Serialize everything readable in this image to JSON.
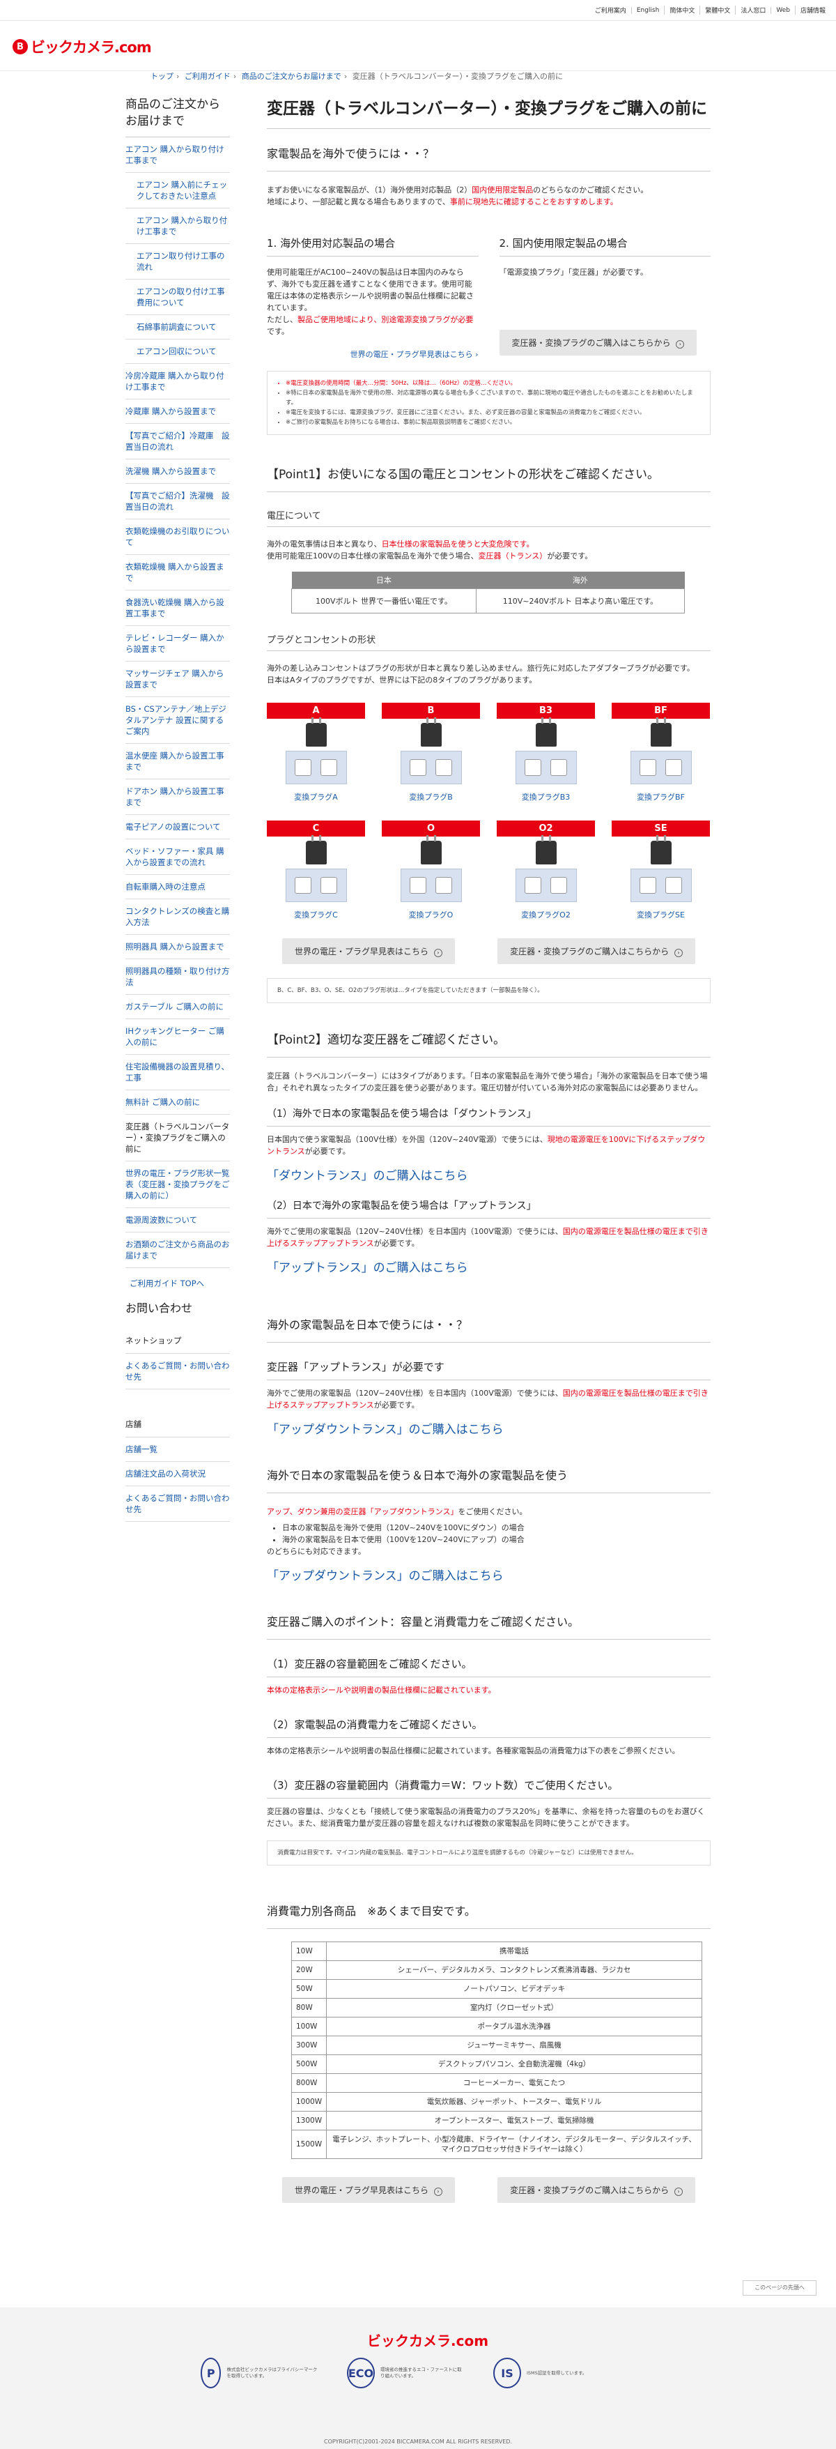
{
  "utility": {
    "links": [
      "ご利用案内",
      "English",
      "簡体中文",
      "繁體中文",
      "法人窓口",
      "Web",
      "店舗情報"
    ]
  },
  "header": {
    "logo_mark": "B",
    "logo_text": "ビックカメラ.com"
  },
  "breadcrumb": {
    "items": [
      "トップ",
      "ご利用ガイド",
      "商品のご注文からお届けまで",
      "変圧器（トラベルコンバーター）・変換プラグをご購入の前に"
    ]
  },
  "sidebar": {
    "title": "商品のご注文から お届けまで",
    "items": [
      {
        "label": "エアコン 購入から取り付け工事まで",
        "sub": false
      },
      {
        "label": "エアコン 購入前にチェックしておきたい注意点",
        "sub": true
      },
      {
        "label": "エアコン 購入から取り付け工事まで",
        "sub": true
      },
      {
        "label": "エアコン取り付け工事の流れ",
        "sub": true
      },
      {
        "label": "エアコンの取り付け工事費用について",
        "sub": true
      },
      {
        "label": "石綿事前調査について",
        "sub": true
      },
      {
        "label": "エアコン回収について",
        "sub": true
      },
      {
        "label": "冷房冷蔵庫 購入から取り付け工事まで",
        "sub": false
      },
      {
        "label": "冷蔵庫 購入から設置まで",
        "sub": false
      },
      {
        "label": "【写真でご紹介】冷蔵庫　設置当日の流れ",
        "sub": false
      },
      {
        "label": "洗濯機 購入から設置まで",
        "sub": false
      },
      {
        "label": "【写真でご紹介】洗濯機　設置当日の流れ",
        "sub": false
      },
      {
        "label": "衣類乾燥機のお引取りについて",
        "sub": false
      },
      {
        "label": "衣類乾燥機 購入から設置まで",
        "sub": false
      },
      {
        "label": "食器洗い乾燥機 購入から設置工事まで",
        "sub": false
      },
      {
        "label": "テレビ・レコーダー 購入から設置まで",
        "sub": false
      },
      {
        "label": "マッサージチェア 購入から設置まで",
        "sub": false
      },
      {
        "label": "BS・CSアンテナ／地上デジタルアンテナ 設置に関するご案内",
        "sub": false
      },
      {
        "label": "温水便座 購入から設置工事まで",
        "sub": false
      },
      {
        "label": "ドアホン 購入から設置工事まで",
        "sub": false
      },
      {
        "label": "電子ピアノの設置について",
        "sub": false
      },
      {
        "label": "ベッド・ソファー・家具 購入から設置までの流れ",
        "sub": false
      },
      {
        "label": "自転車購入時の注意点",
        "sub": false
      },
      {
        "label": "コンタクトレンズの検査と購入方法",
        "sub": false
      },
      {
        "label": "照明器具 購入から設置まで",
        "sub": false
      },
      {
        "label": "照明器具の種類・取り付け方法",
        "sub": false
      },
      {
        "label": "ガステーブル ご購入の前に",
        "sub": false
      },
      {
        "label": "IHクッキングヒーター ご購入の前に",
        "sub": false
      },
      {
        "label": "住宅設備機器の設置見積り、工事",
        "sub": false
      },
      {
        "label": "無料計 ご購入の前に",
        "sub": false
      },
      {
        "label": "変圧器（トラベルコンバーター）・変換プラグをご購入の前に",
        "sub": false,
        "current": true
      },
      {
        "label": "世界の電圧・プラグ形状一覧表（変圧器・変換プラグをご購入の前に）",
        "sub": false
      },
      {
        "label": "電源周波数について",
        "sub": false
      },
      {
        "label": "お酒類のご注文から商品のお届けまで",
        "sub": false
      }
    ],
    "top_link": "ご利用ガイド TOPへ",
    "contact_title": "お問い合わせ",
    "net_title": "ネットショップ",
    "net_items": [
      "よくあるご質問・お問い合わせ先"
    ],
    "store_title": "店舗",
    "store_items": [
      "店舗一覧",
      "店舗注文品の入荷状況",
      "よくあるご質問・お問い合わせ先"
    ]
  },
  "main": {
    "title": "変圧器（トラベルコンバーター）・変換プラグをご購入の前に",
    "s1": {
      "h": "家電製品を海外で使うには・・？",
      "t1": "まずお使いになる家電製品が、（1）海外使用対応製品（2）",
      "t1r": "国内使用限定製品",
      "t1b": "のどちらなのかご確認ください。",
      "t2": "地域により、一部記載と異なる場合もありますので、",
      "t2r": "事前に現地先に確認することをおすすめします。"
    },
    "c1": {
      "h": "1. 海外使用対応製品の場合",
      "t": "使用可能電圧がAC100~240Vの製品は日本国内のみならず、海外でも変圧器を通すことなく使用できます。使用可能電圧は本体の定格表示シールや説明書の製品仕様欄に記載されています。",
      "t2": "ただし、",
      "t2r": "製品ご使用地域により、別途電源変換プラグが必要",
      "t2b": "です。",
      "btn": "世界の電圧・プラグ早見表はこちら"
    },
    "c2": {
      "h": "2. 国内使用限定製品の場合",
      "t": "「電源変換プラグ」「変圧器」が必要です。",
      "btn": "変圧器・変換プラグのご購入はこちらから"
    },
    "note1": [
      "※電圧変換器の使用時間（最大…分間：50Hz、以降は…（60Hz）の定格…ください。",
      "※特に日本の家電製品を海外で使用の際、対応電源等の異なる場合も多くございますので、事前に現地の電圧や適合したものを選ぶことをお勧めいたします。",
      "※電圧を変換するには、電源変換プラグ、変圧器にご注意ください。また、必ず変圧器の容量と家電製品の消費電力をご確認ください。",
      "※ご旅行の家電製品をお持ちになる場合は、事前に製品取扱説明書をご確認ください。"
    ],
    "p1": {
      "h": "【Point1】お使いになる国の電圧とコンセントの形状をご確認ください。",
      "sub1": "電圧について",
      "t1": "海外の電気事情は日本と異なり、",
      "t1r": "日本仕様の家電製品を使うと大変危険です。",
      "t2": "使用可能電圧100Vの日本仕様の家電製品を海外で使う場合、",
      "t2r": "変圧器（トランス）",
      "t2b": "が必要です。",
      "th": [
        "日本",
        "海外"
      ],
      "td": [
        "100Vボルト 世界で一番低い電圧です。",
        "110V~240Vボルト 日本より高い電圧です。"
      ],
      "sub2": "プラグとコンセントの形状",
      "t3": "海外の差し込みコンセントはプラグの形状が日本と異なり差し込めません。旅行先に対応したアダプタープラグが必要です。",
      "t4": "日本はAタイプのプラグですが、世界には下記の8タイプのプラグがあります。",
      "plugs": [
        {
          "lab": "A",
          "cap": "変換プラグA"
        },
        {
          "lab": "B",
          "cap": "変換プラグB"
        },
        {
          "lab": "B3",
          "cap": "変換プラグB3"
        },
        {
          "lab": "BF",
          "cap": "変換プラグBF"
        },
        {
          "lab": "C",
          "cap": "変換プラグC"
        },
        {
          "lab": "O",
          "cap": "変換プラグO"
        },
        {
          "lab": "O2",
          "cap": "変換プラグO2"
        },
        {
          "lab": "SE",
          "cap": "変換プラグSE"
        }
      ],
      "btn1": "世界の電圧・プラグ早見表はこちら",
      "btn2": "変圧器・変換プラグのご購入はこちらから",
      "note": "B、C、BF、B3、O、SE、O2のプラグ形状は…タイプを指定していただきます（一部製品を除く）。"
    },
    "p2": {
      "h": "【Point2】適切な変圧器をご確認ください。",
      "t": "変圧器（トラベルコンバーター）には3タイプがあります。「日本の家電製品を海外で使う場合」「海外の家電製品を日本で使う場合」それぞれ異なったタイプの変圧器を使う必要があります。電圧切替が付いている海外対応の家電製品には必要ありません。",
      "s1h": "（1）海外で日本の家電製品を使う場合は「ダウントランス」",
      "s1t": "日本国内で使う家電製品（100V仕様）を外国（120V~240V電源）で使うには、",
      "s1r": "現地の電源電圧を100Vに下げるステップダウントランス",
      "s1b": "が必要です。",
      "s1l": "「ダウントランス」のご購入はこちら",
      "s2h": "（2）日本で海外の家電製品を使う場合は「アップトランス」",
      "s2t": "海外でご使用の家電製品（120V~240V仕様）を日本国内（100V電源）で使うには、",
      "s2r": "国内の電源電圧を製品仕様の電圧まで引き上げるステップアップトランス",
      "s2b": "が必要です。",
      "s2l": "「アップトランス」のご購入はこちら"
    },
    "s3": {
      "h": "海外の家電製品を日本で使うには・・？",
      "sh": "変圧器「アップトランス」が必要です",
      "t": "海外でご使用の家電製品（120V~240V仕様）を日本国内（100V電源）で使うには、",
      "r": "国内の電源電圧を製品仕様の電圧まで引き上げるステップアップトランス",
      "b": "が必要です。",
      "l": "「アップダウントランス」のご購入はこちら"
    },
    "s4": {
      "h": "海外で日本の家電製品を使う＆日本で海外の家電製品を使う",
      "r": "アップ、ダウン兼用の変圧器「アップダウントランス」",
      "b": "をご使用ください。",
      "li": [
        "日本の家電製品を海外で使用（120V~240Vを100Vにダウン）の場合",
        "海外の家電製品を日本で使用（100Vを120V~240Vにアップ）の場合"
      ],
      "t2": "のどちらにも対応できます。",
      "l": "「アップダウントランス」のご購入はこちら"
    },
    "s5": {
      "h": "変圧器ご購入のポイント：容量と消費電力をご確認ください。",
      "a": "（1）変圧器の容量範囲をご確認ください。",
      "ar": "本体の定格表示シールや説明書の製品仕様欄に記載されています。",
      "b": "（2）家電製品の消費電力をご確認ください。",
      "bt": "本体の定格表示シールや説明書の製品仕様欄に記載されています。各種家電製品の消費電力は下の表をご参照ください。",
      "c": "（3）変圧器の容量範囲内（消費電力＝W：ワット数）でご使用ください。",
      "ct": "変圧器の容量は、少なくとも「接続して使う家電製品の消費電力のプラス20%」を基準に、余裕を持った容量のものをお選びください。また、総消費電力量が変圧器の容量を超えなければ複数の家電製品を同時に使うことができます。",
      "note": "消費電力は目安です。マイコン内蔵の電気製品、電子コントロールにより温度を調節するもの（冷蔵ジャーなど）には使用できません。"
    },
    "s6": {
      "h": "消費電力別各商品　※あくまで目安です。",
      "rows": [
        [
          "10W",
          "携帯電話"
        ],
        [
          "20W",
          "シェーバー、デジタルカメラ、コンタクトレンズ煮沸消毒器、ラジカセ"
        ],
        [
          "50W",
          "ノートパソコン、ビデオデッキ"
        ],
        [
          "80W",
          "室内灯（クローゼット式）"
        ],
        [
          "100W",
          "ポータブル温水洗浄器"
        ],
        [
          "300W",
          "ジューサーミキサー、扇風機"
        ],
        [
          "500W",
          "デスクトップパソコン、全自動洗濯機（4kg）"
        ],
        [
          "800W",
          "コーヒーメーカー、電気こたつ"
        ],
        [
          "1000W",
          "電気炊飯器、ジャーポット、トースター、電気ドリル"
        ],
        [
          "1300W",
          "オーブントースター、電気ストーブ、電気掃除機"
        ],
        [
          "1500W",
          "電子レンジ、ホットプレート、小型冷蔵庫、ドライヤー（ナノイオン、デジタルモーター、デジタルスイッチ、マイクロプロセッサ付きドライヤーは除く）"
        ]
      ],
      "btn1": "世界の電圧・プラグ早見表はこちら",
      "btn2": "変圧器・変換プラグのご購入はこちらから"
    }
  },
  "pagetop": "このページの先頭へ",
  "footer": {
    "logo": "ビックカメラ.com",
    "badges": [
      {
        "mark": "P",
        "text": "株式会社ビックカメラはプライバシーマークを取得しています。"
      },
      {
        "mark": "ECO",
        "text": "環境省の推進するエコ・ファーストに取り組んでいます。"
      },
      {
        "mark": "IS",
        "text": "ISMS認証を取得しています。"
      }
    ],
    "copyright": "COPYRIGHT(C)2001-2024 BICCAMERA.COM ALL RIGHTS RESERVED."
  }
}
